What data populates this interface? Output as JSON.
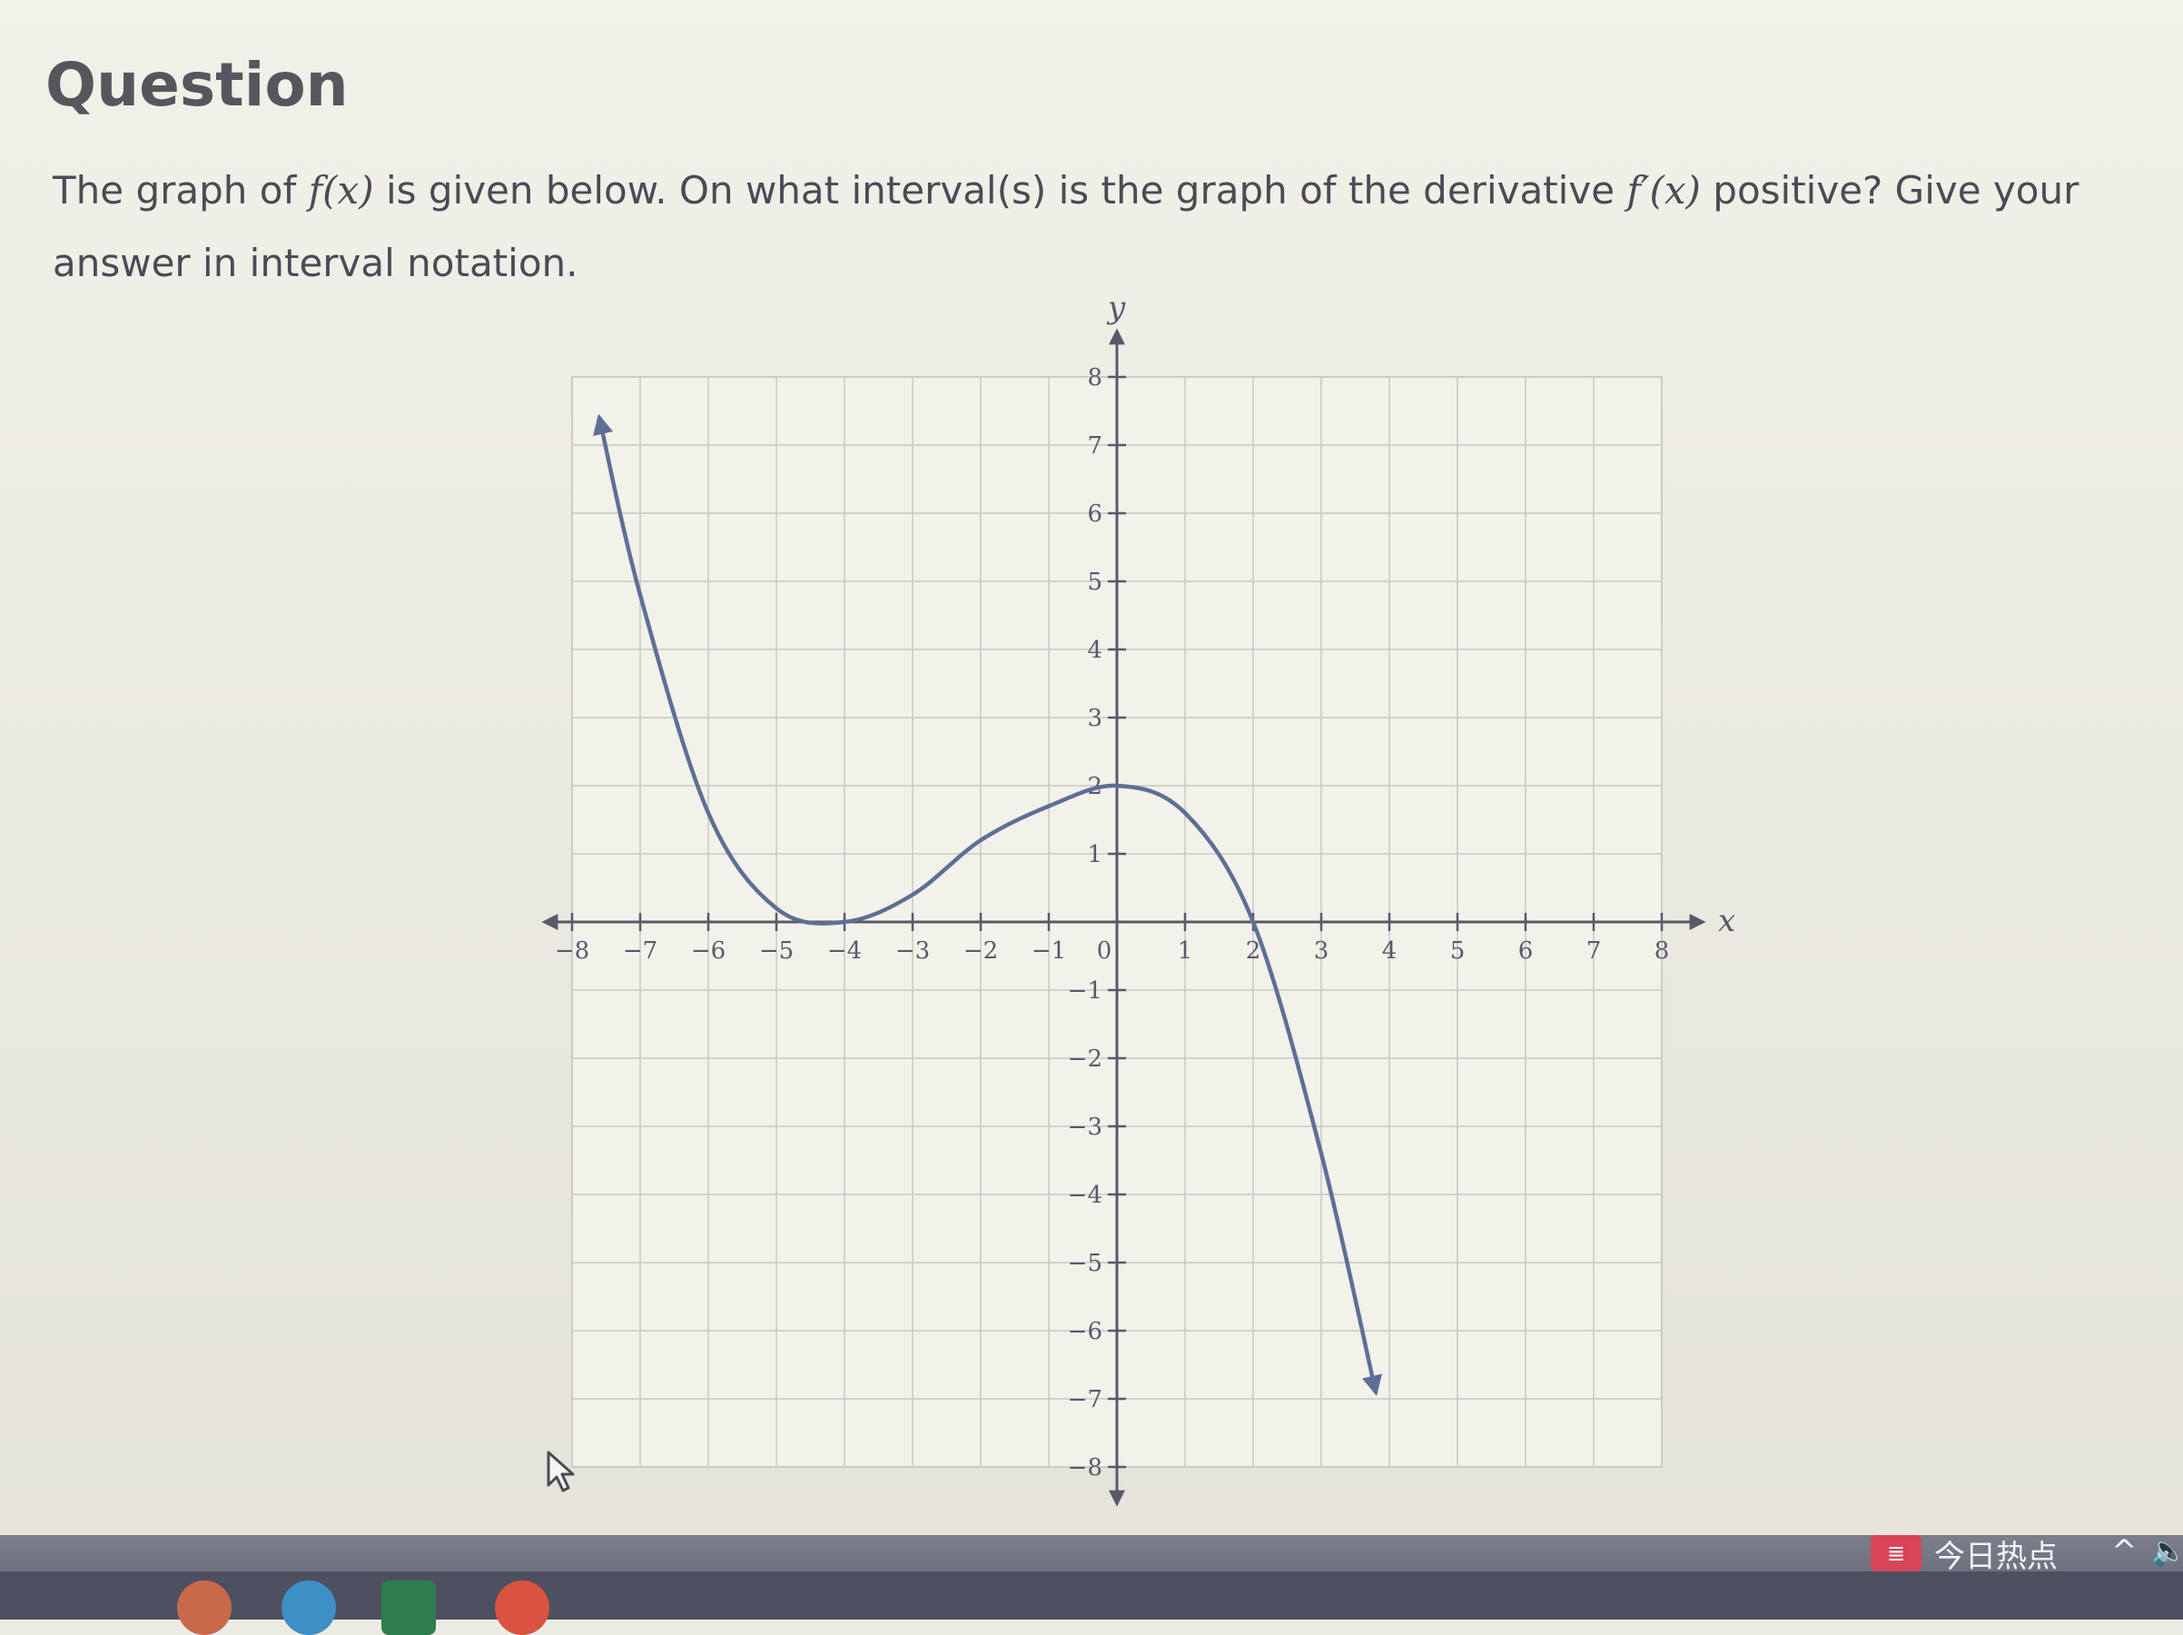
{
  "question": {
    "title": "Question",
    "text_a": "The graph of ",
    "f_x": "f(x)",
    "text_b": " is given below. On what interval(s) is the graph of the derivative ",
    "fprime_x": "f′(x)",
    "text_c": " positive? Give your answer in interval notation."
  },
  "chart_data": {
    "type": "line",
    "xlabel": "x",
    "ylabel": "y",
    "xlim": [
      -8,
      8
    ],
    "ylim": [
      -8,
      8
    ],
    "grid": true,
    "xticks": [
      "-8",
      "-7",
      "-6",
      "-5",
      "-4",
      "-3",
      "-2",
      "-1",
      "0",
      "1",
      "2",
      "3",
      "4",
      "5",
      "6",
      "7",
      "8"
    ],
    "yticks": [
      "8",
      "7",
      "6",
      "5",
      "4",
      "3",
      "2",
      "1",
      "-1",
      "-2",
      "-3",
      "-4",
      "-5",
      "-6",
      "-7",
      "-8"
    ],
    "series": [
      {
        "color": "#5e6f96",
        "arrows": "both ends",
        "points": [
          {
            "x": -7.6,
            "y": 7.4
          },
          {
            "x": -7,
            "y": 4.8
          },
          {
            "x": -6,
            "y": 1.6
          },
          {
            "x": -5,
            "y": 0.2
          },
          {
            "x": -4,
            "y": 0
          },
          {
            "x": -3,
            "y": 0.4
          },
          {
            "x": -2,
            "y": 1.2
          },
          {
            "x": -1,
            "y": 1.7
          },
          {
            "x": 0,
            "y": 2
          },
          {
            "x": 1,
            "y": 1.6
          },
          {
            "x": 2,
            "y": 0
          },
          {
            "x": 3,
            "y": -3.4
          },
          {
            "x": 3.8,
            "y": -6.9
          }
        ]
      }
    ]
  },
  "taskbar": {
    "news_icon_text": "≣",
    "news_label": "今日热点",
    "chevron": "^",
    "speaker": "🔈"
  },
  "colors": {
    "curve": "#5e6f96",
    "axis": "#59596a",
    "grid": "#c8c8c4",
    "text": "#4b4b55"
  }
}
